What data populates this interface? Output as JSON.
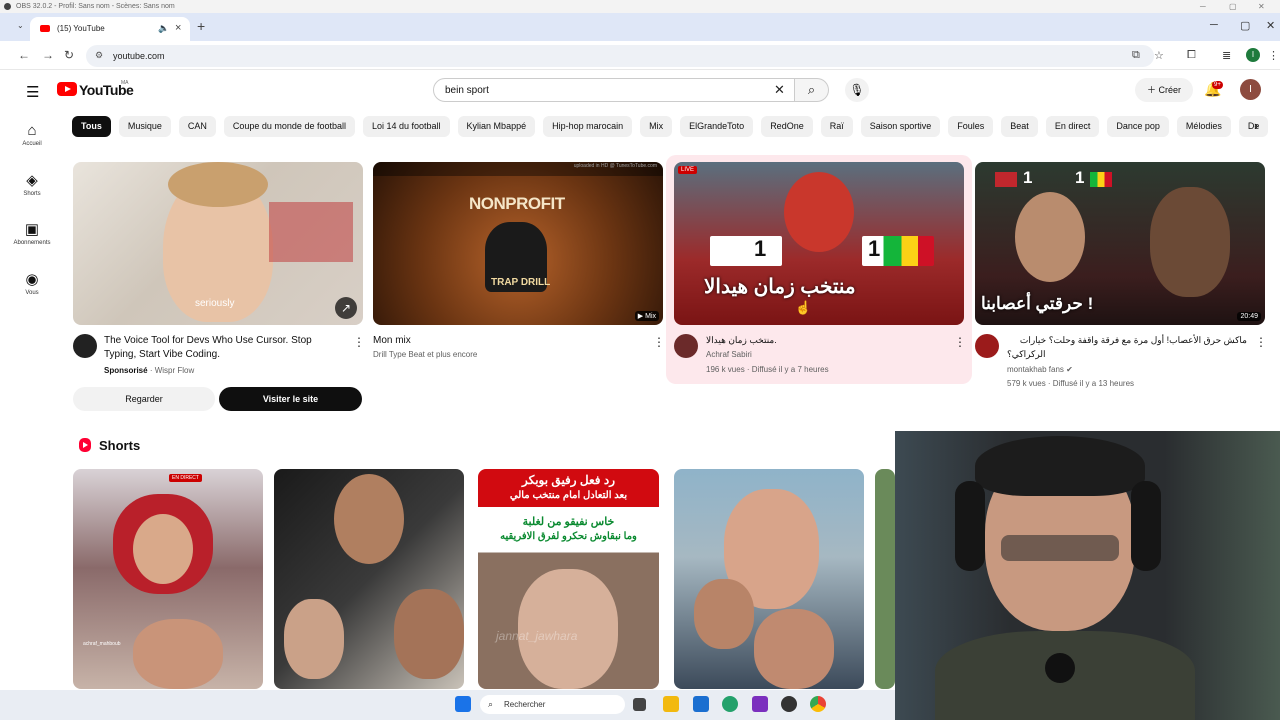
{
  "obs": {
    "title": "OBS 32.0.2 - Profil: Sans nom - Scènes: Sans nom"
  },
  "browser": {
    "tab_title": "(15) YouTube",
    "url": "youtube.com",
    "profile_initial": "I"
  },
  "youtube": {
    "region": "MA",
    "search_query": "bein sport",
    "create_label": "Créer",
    "notif_count": "9+",
    "avatar_initial": "I",
    "sidebar": [
      {
        "icon": "⌂",
        "label": "Accueil"
      },
      {
        "icon": "◈",
        "label": "Shorts"
      },
      {
        "icon": "▣",
        "label": "Abonnements"
      },
      {
        "icon": "◉",
        "label": "Vous"
      }
    ],
    "chips": [
      "Tous",
      "Musique",
      "CAN",
      "Coupe du monde de football",
      "Loi 14 du football",
      "Kylian Mbappé",
      "Hip-hop marocain",
      "Mix",
      "ElGrandeToto",
      "RedOne",
      "Raï",
      "Saison sportive",
      "Foules",
      "Beat",
      "En direct",
      "Dance pop",
      "Mélodies",
      "De"
    ],
    "videos": [
      {
        "title_line1": "The Voice Tool for Devs Who Use Cursor. Stop",
        "title_line2": "Typing, Start Vibe Coding.",
        "sponsored": "Sponsorisé",
        "advertiser": "· Wispr Flow",
        "thumb_caption": "seriously",
        "btn_secondary": "Regarder",
        "btn_primary": "Visiter le site"
      },
      {
        "title": "Mon mix",
        "meta": "Drill Type Beat et plus encore",
        "thumb_text1": "NONPROFIT",
        "thumb_text2": "TRAP DRILL",
        "thumb_top": "uploaded in HD @ TunesToTube.com",
        "badge": "Mix"
      },
      {
        "title": "منتخب زمان هيدالا.",
        "channel": "Achraf Sabiri",
        "meta": "196 k vues · Diffusé il y a 7 heures",
        "live_label": "LIVE",
        "thumb_text": "منتخب زمان هيدالا",
        "score_a": "1",
        "score_b": "1"
      },
      {
        "title_line1": "ماكش حرق الأعصاب! أول مرة مع فرقة واقفة وحلت؟ خيارات",
        "title_line2": "الركراكي؟",
        "channel": "montakhab fans",
        "meta": "579 k vues · Diffusé il y a 13 heures",
        "duration": "20:49",
        "thumb_text": "حرقتي أعصابنا !",
        "score_a": "1",
        "score_b": "1"
      }
    ],
    "shorts_heading": "Shorts",
    "shorts": [
      {
        "overlay": "EN DIRECT",
        "caption": "achraf_mahboub"
      },
      {
        "overlay": ""
      },
      {
        "line1": "رد فعل رفيق بوبكر",
        "line2": "بعد التعادل امام منتخب مالي",
        "line3": "خاس نفيقو من لغلبة",
        "line4": "وما نبقاوش نحكرو لفرق الافريقيه",
        "watermark": "jannat_jawhara"
      },
      {
        "overlay": ""
      }
    ]
  },
  "taskbar": {
    "search_placeholder": "Rechercher"
  },
  "colors": {
    "yt_red": "#ff0000",
    "chip_active": "#0f0f0f",
    "highlight_card": "#fde8ec"
  }
}
